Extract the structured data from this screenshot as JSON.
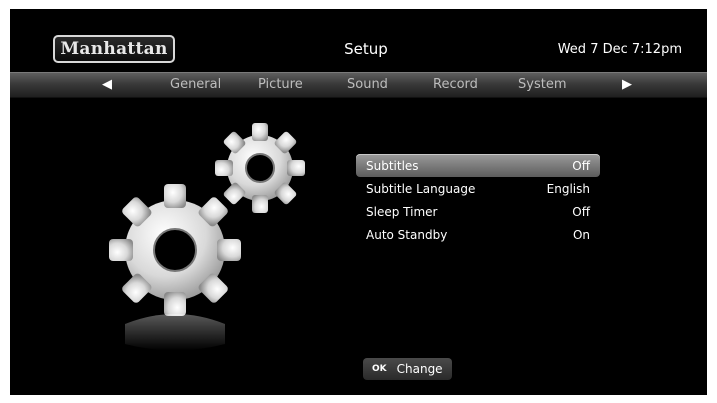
{
  "header": {
    "logo_text": "Manhattan",
    "title": "Setup",
    "clock": "Wed 7 Dec 7:12pm"
  },
  "tabs": {
    "prev_icon": "left-arrow-icon",
    "next_icon": "right-arrow-icon",
    "items": [
      {
        "label": "General"
      },
      {
        "label": "Picture"
      },
      {
        "label": "Sound"
      },
      {
        "label": "Record"
      },
      {
        "label": "System"
      }
    ]
  },
  "illustration": {
    "icon": "gears-icon"
  },
  "menu": {
    "selected_index": 0,
    "items": [
      {
        "label": "Subtitles",
        "value": "Off"
      },
      {
        "label": "Subtitle Language",
        "value": "English"
      },
      {
        "label": "Sleep Timer",
        "value": "Off"
      },
      {
        "label": "Auto Standby",
        "value": "On"
      }
    ]
  },
  "hint": {
    "key": "OK",
    "label": "Change"
  },
  "colors": {
    "background": "#000000",
    "selection": "#8c8c8c",
    "tab_text": "#bdbdbd"
  }
}
